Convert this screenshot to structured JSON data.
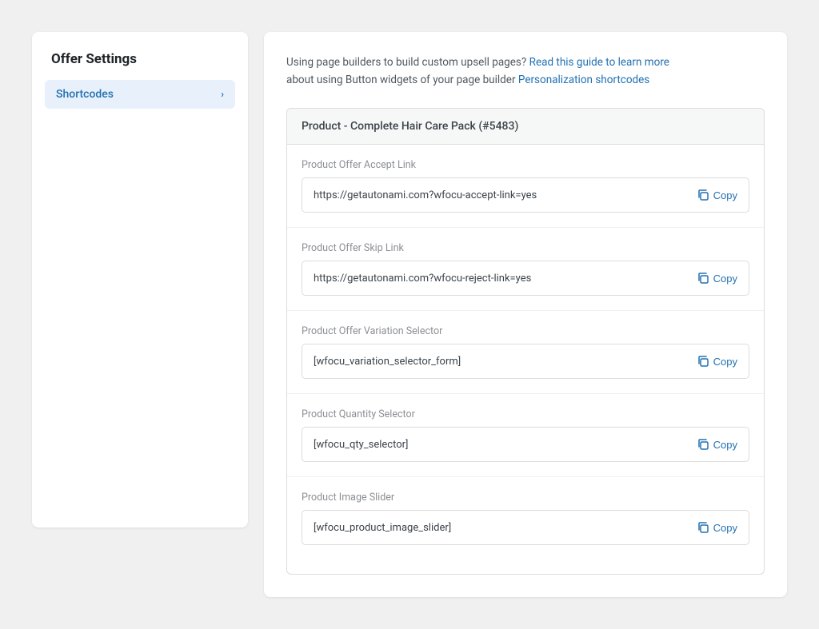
{
  "sidebar": {
    "title": "Offer Settings",
    "items": [
      {
        "label": "Shortcodes",
        "active": true
      }
    ]
  },
  "main": {
    "intro_line1": "Using page builders to build custom upsell pages?",
    "intro_link1": "Read this guide to learn more",
    "intro_line2": "about using Button widgets of your page builder",
    "intro_link2": "Personalization shortcodes",
    "product_header": "Product - Complete Hair Care Pack (#5483)",
    "shortcode_groups": [
      {
        "label": "Product Offer Accept Link",
        "value": "https://getautonami.com?wfocu-accept-link=yes",
        "copy_label": "Copy"
      },
      {
        "label": "Product Offer Skip Link",
        "value": "https://getautonami.com?wfocu-reject-link=yes",
        "copy_label": "Copy",
        "has_arrow": true
      },
      {
        "label": "Product Offer Variation Selector",
        "value": "[wfocu_variation_selector_form]",
        "copy_label": "Copy"
      },
      {
        "label": "Product Quantity Selector",
        "value": "[wfocu_qty_selector]",
        "copy_label": "Copy"
      },
      {
        "label": "Product Image Slider",
        "value": "[wfocu_product_image_slider]",
        "copy_label": "Copy"
      }
    ]
  },
  "colors": {
    "link": "#2271b1",
    "copy": "#2271b1",
    "arrow": "#cc0000"
  }
}
